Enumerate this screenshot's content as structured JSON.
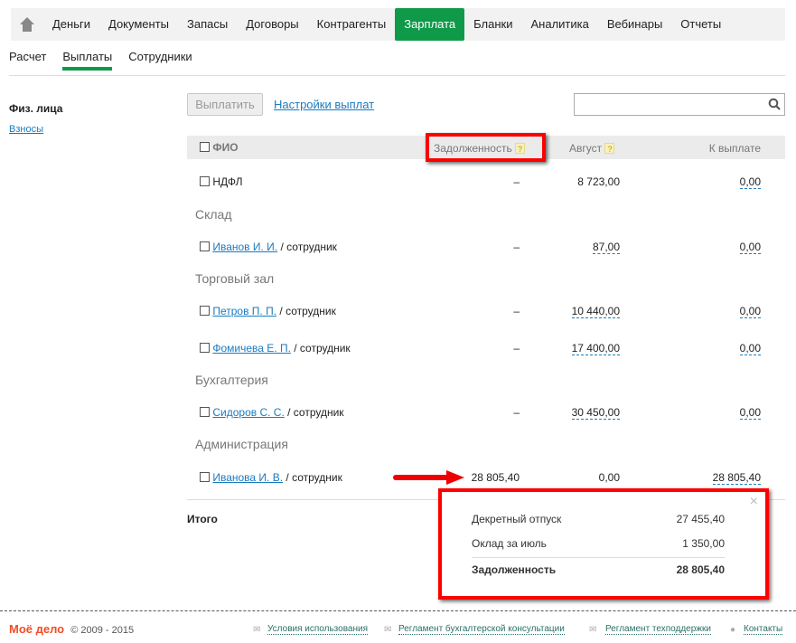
{
  "nav": {
    "items": [
      "Деньги",
      "Документы",
      "Запасы",
      "Договоры",
      "Контрагенты",
      "Зарплата",
      "Бланки",
      "Аналитика",
      "Вебинары",
      "Отчеты"
    ],
    "active": "Зарплата"
  },
  "subtabs": {
    "items": [
      "Расчет",
      "Выплаты",
      "Сотрудники"
    ],
    "active": "Выплаты"
  },
  "sidebar": {
    "heading": "Физ. лица",
    "link": "Взносы"
  },
  "toolbar": {
    "pay": "Выплатить",
    "settings": "Настройки выплат",
    "search_placeholder": ""
  },
  "table": {
    "headers": {
      "name": "ФИО",
      "debt": "Задолженность",
      "month": "Август",
      "topay": "К выплате"
    },
    "help": "?",
    "rows": [
      {
        "type": "row",
        "name": "НДФЛ",
        "role": "",
        "debt": "–",
        "month": "8 723,00",
        "topay": "0,00"
      },
      {
        "type": "group",
        "name": "Склад"
      },
      {
        "type": "row",
        "name": "Иванов И. И.",
        "role": " / сотрудник",
        "debt": "–",
        "month": "87,00",
        "topay": "0,00"
      },
      {
        "type": "group",
        "name": "Торговый зал"
      },
      {
        "type": "row",
        "name": "Петров П. П.",
        "role": " / сотрудник",
        "debt": "–",
        "month": "10 440,00",
        "topay": "0,00"
      },
      {
        "type": "row",
        "name": "Фомичева Е. П.",
        "role": " / сотрудник",
        "debt": "–",
        "month": "17 400,00",
        "topay": "0,00"
      },
      {
        "type": "group",
        "name": "Бухгалтерия"
      },
      {
        "type": "row",
        "name": "Сидоров С. С.",
        "role": " / сотрудник",
        "debt": "–",
        "month": "30 450,00",
        "topay": "0,00"
      },
      {
        "type": "group",
        "name": "Администрация"
      },
      {
        "type": "row",
        "name": "Иванова И. В.",
        "role": " / сотрудник",
        "debt": "28 805,40",
        "month": "0,00",
        "topay": "28 805,40"
      }
    ],
    "total_label": "Итого"
  },
  "popup": {
    "close": "×",
    "items": [
      {
        "label": "Декретный отпуск",
        "value": "27 455,40"
      },
      {
        "label": "Оклад за июль",
        "value": "1 350,00"
      }
    ],
    "total": {
      "label": "Задолженность",
      "value": "28 805,40"
    }
  },
  "footer": {
    "logo": "Моё дело",
    "copyright": "© 2009 - 2015",
    "links": [
      "Условия использования",
      "Регламент бухгалтерской консультации",
      "Регламент техподдержки",
      "Контакты"
    ]
  },
  "colors": {
    "accent": "#0e9a48",
    "link": "#1a7bbf",
    "highlight": "#ff0000"
  }
}
